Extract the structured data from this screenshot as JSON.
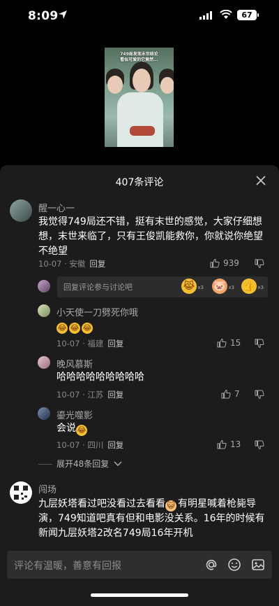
{
  "status": {
    "time": "8:09",
    "battery": "67"
  },
  "video": {
    "caption_line1": "749局发现末世结论",
    "caption_line2": "看似可爱的它竟然..."
  },
  "comments_sheet": {
    "title": "407条评论",
    "close_icon": "close-icon"
  },
  "comments": [
    {
      "user": "醒一心一",
      "text": "我觉得749局还不错，挺有末世的感觉，大家仔细想想，末世来临了，只有王俊凯能救你，你就说你绝望不绝望",
      "date": "10-07 · 安徽",
      "reply": "回复",
      "likes": "939"
    }
  ],
  "reply_prompt": {
    "placeholder": "回复评论参与讨论吧",
    "reactions": [
      {
        "icon": "laugh-cry-emoji",
        "count": "x3"
      },
      {
        "icon": "pig-emoji",
        "count": "x3"
      },
      {
        "icon": "thumbs-up-emoji",
        "count": "x3"
      }
    ]
  },
  "replies": [
    {
      "user": "小天使一刀劈死你哦",
      "text": "😂😂😂",
      "date": "10-07 · 福建",
      "reply": "回复",
      "likes": "15"
    },
    {
      "user": "晚风慕斯",
      "text": "哈哈哈哈哈哈哈哈哈",
      "date": "10-07 · 江苏",
      "reply": "回复",
      "likes": "7"
    },
    {
      "user": "鎏光噬影",
      "text": "会说",
      "emoji": "😂",
      "date": "10-07 · 四川",
      "reply": "回复",
      "likes": "13"
    }
  ],
  "expand_label": "展开48条回复",
  "comment2": {
    "user": "闯场",
    "text_a": "九层妖塔看过吧没看过去看看",
    "text_b": "有明星喊着枪毙导演，749知道吧真有但和电影没关系。16年的时候有新闻九层妖塔2改名749局16年开机"
  },
  "input": {
    "placeholder": "评论有温暖，善意有回报"
  },
  "colors": {
    "sheet_bg": "#1c1c1c",
    "input_bg": "#2e2e2e",
    "muted_text": "#8a8a8a"
  }
}
